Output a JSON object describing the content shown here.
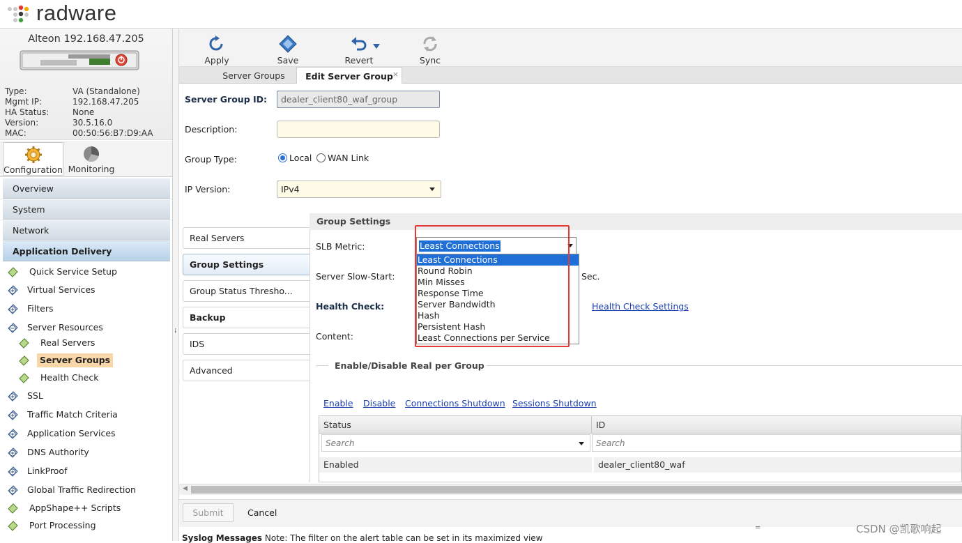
{
  "brand": {
    "logo_text": "radware"
  },
  "device": {
    "title": "Alteon 192.168.47.205",
    "info": [
      {
        "label": "Type:",
        "value": "VA (Standalone)"
      },
      {
        "label": "Mgmt IP:",
        "value": "192.168.47.205"
      },
      {
        "label": "HA Status:",
        "value": "None"
      },
      {
        "label": "Version:",
        "value": "30.5.16.0"
      },
      {
        "label": "MAC:",
        "value": "00:50:56:B7:D9:AA"
      }
    ]
  },
  "mode_tabs": {
    "configuration": "Configuration",
    "monitoring": "Monitoring"
  },
  "nav_sections": [
    "Overview",
    "System",
    "Network",
    "Application Delivery"
  ],
  "nav_tree": [
    "Quick Service Setup",
    "Virtual Services",
    "Filters",
    "Server Resources",
    "Real Servers",
    "Server Groups",
    "Health Check",
    "SSL",
    "Traffic Match Criteria",
    "Application Services",
    "DNS Authority",
    "LinkProof",
    "Global Traffic Redirection",
    "AppShape++ Scripts",
    "Port Processing"
  ],
  "toolbar": {
    "apply": "Apply",
    "save": "Save",
    "revert": "Revert",
    "sync": "Sync"
  },
  "tabs": {
    "server_groups": "Server Groups",
    "edit_server_group": "Edit Server Group",
    "close": "×"
  },
  "form": {
    "server_group_id_label": "Server Group ID:",
    "server_group_id_value": "dealer_client80_waf_group",
    "description_label": "Description:",
    "description_value": "",
    "group_type_label": "Group Type:",
    "group_type_local": "Local",
    "group_type_wan": "WAN Link",
    "group_type_selected": "Local",
    "ip_version_label": "IP Version:",
    "ip_version_value": "IPv4"
  },
  "side_tabs": [
    "Real Servers",
    "Group Settings",
    "Group Status Thresho...",
    "Backup",
    "IDS",
    "Advanced"
  ],
  "group_settings": {
    "header": "Group Settings",
    "slb_metric_label": "SLB Metric:",
    "slb_metric_value": "Least Connections",
    "slb_metric_options": [
      "Least Connections",
      "Round Robin",
      "Min Misses",
      "Response Time",
      "Server Bandwidth",
      "Hash",
      "Persistent Hash",
      "Least Connections per Service"
    ],
    "slow_start_label": "Server Slow-Start:",
    "slow_start_unit": "Sec.",
    "health_check_label": "Health Check:",
    "health_check_link": "Health Check Settings",
    "content_label": "Content:"
  },
  "enable_disable": {
    "title": "Enable/Disable Real per Group",
    "actions": [
      "Enable",
      "Disable",
      "Connections Shutdown",
      "Sessions Shutdown"
    ],
    "columns": [
      "Status",
      "ID"
    ],
    "search_placeholder": "Search",
    "rows": [
      {
        "status": "Enabled",
        "id": "dealer_client80_waf"
      }
    ]
  },
  "bottom": {
    "submit": "Submit",
    "cancel": "Cancel"
  },
  "syslog": {
    "title": "Syslog Messages",
    "note": "Note: The filter on the alert table can be set in its maximized view"
  },
  "watermark": "CSDN @凯歌响起",
  "colors": {
    "accent": "#1f6fd6",
    "highlight_box": "#e53935",
    "selected_tree": "#f8d6a8"
  }
}
